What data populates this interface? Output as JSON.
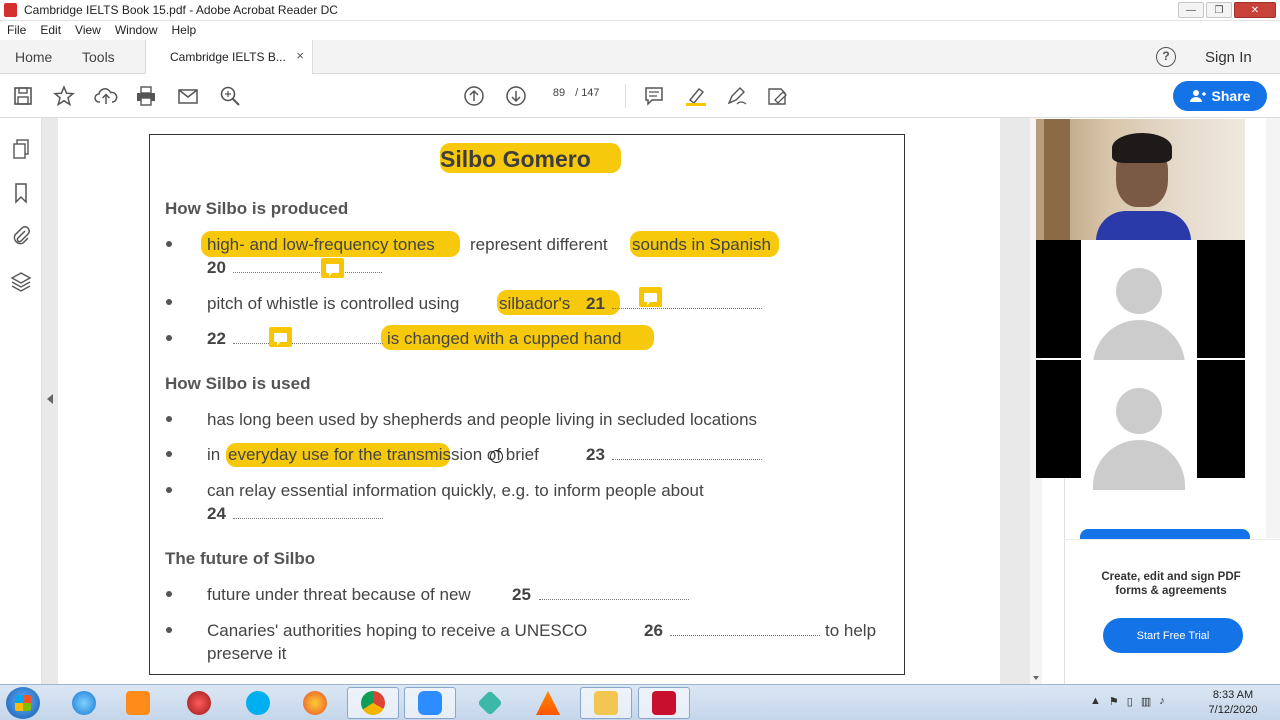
{
  "window": {
    "title": "Cambridge IELTS Book 15.pdf - Adobe Acrobat Reader DC",
    "min": "—",
    "max": "❐",
    "close": "✕"
  },
  "menu": [
    "File",
    "Edit",
    "View",
    "Window",
    "Help"
  ],
  "tabs": {
    "home": "Home",
    "tools": "Tools",
    "document": "Cambridge IELTS B...",
    "close": "×"
  },
  "header": {
    "help": "?",
    "signin": "Sign In",
    "share": "Share"
  },
  "toolbar": {
    "page_current": "89",
    "page_sep": "/",
    "page_total": "147"
  },
  "document": {
    "title": "Silbo Gomero",
    "sections": [
      {
        "heading": "How Silbo is produced"
      },
      {
        "heading": "How Silbo is used"
      },
      {
        "heading": "The future of Silbo"
      }
    ],
    "lines": {
      "l1a": "high- and low-frequency tones",
      "l1b": "represent different",
      "l1c": "sounds in Spanish",
      "l1d": "20",
      "l2a": "pitch of whistle is controlled using",
      "l2b": "silbador's",
      "l2c": "21",
      "l3a": "22",
      "l3b": "is changed with a cupped hand",
      "l4": "has long been used by shepherds and people living in secluded locations",
      "l5a": "in",
      "l5b": "everyday use for the transmission of brief",
      "l5c": "23",
      "l6a": "can relay essential information quickly, e.g. to inform people about",
      "l6b": "24",
      "l7a": "future under threat because of new",
      "l7b": "25",
      "l8a": "Canaries' authorities hoping to receive a UNESCO",
      "l8b": "26",
      "l8c": "to help",
      "l8d": "preserve it"
    }
  },
  "right_panel": {
    "promo": "Create, edit and sign PDF forms & agreements",
    "trial": "Start Free Trial"
  },
  "taskbar": {
    "time": "8:33 AM",
    "date": "7/12/2020"
  }
}
